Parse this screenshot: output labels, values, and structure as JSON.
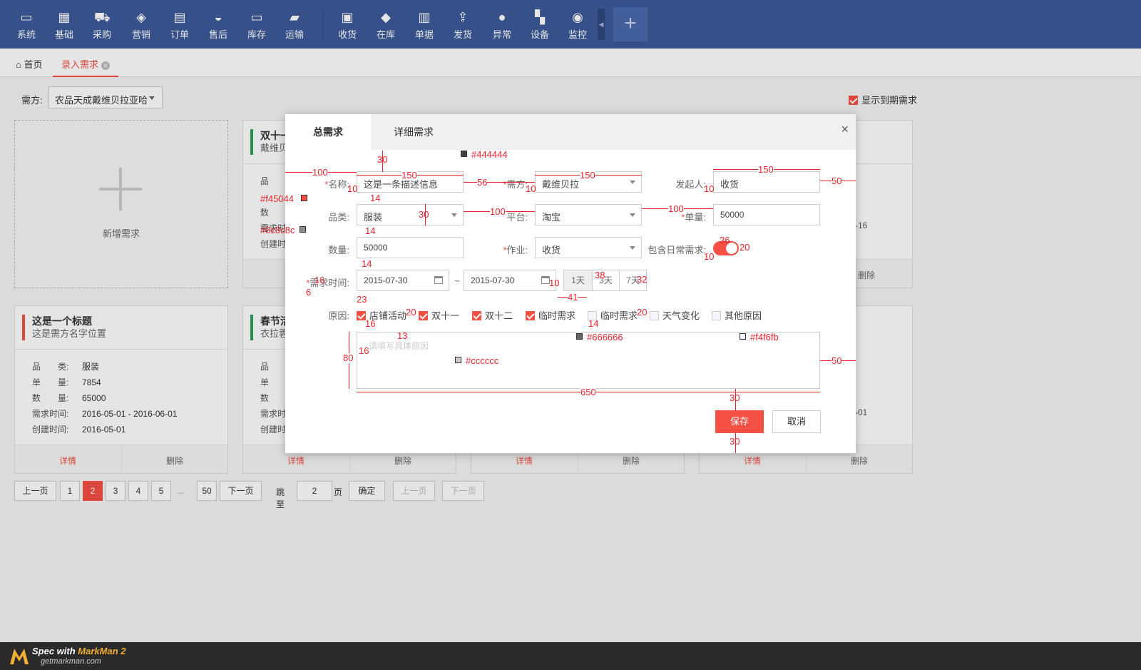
{
  "nav": {
    "items": [
      {
        "label": "系统",
        "icon": "monitor-icon"
      },
      {
        "label": "基础",
        "icon": "grid-icon"
      },
      {
        "label": "采购",
        "icon": "cart-icon"
      },
      {
        "label": "营销",
        "icon": "tag-icon"
      },
      {
        "label": "订单",
        "icon": "document-icon"
      },
      {
        "label": "售后",
        "icon": "headset-icon"
      },
      {
        "label": "库存",
        "icon": "inbox-icon"
      },
      {
        "label": "运输",
        "icon": "truck-icon"
      },
      {
        "label": "收货",
        "icon": "receive-icon"
      },
      {
        "label": "在库",
        "icon": "layers-icon"
      },
      {
        "label": "单据",
        "icon": "receipt-icon"
      },
      {
        "label": "发货",
        "icon": "upload-icon"
      },
      {
        "label": "异常",
        "icon": "alert-icon"
      },
      {
        "label": "设备",
        "icon": "devices-icon"
      },
      {
        "label": "监控",
        "icon": "camera-icon"
      }
    ],
    "add_label": "+"
  },
  "tabs": {
    "home": "首页",
    "active": "录入需求"
  },
  "filter": {
    "label": "需方:",
    "value": "农品天成戴维贝拉亚哈",
    "show_expired": "显示到期需求"
  },
  "cards": {
    "new_label": "新增需求",
    "c1": {
      "title": "这是一个标题",
      "subtitle": "这是需方名字位置",
      "rows": [
        {
          "k": "品　　类:",
          "v": "服装"
        },
        {
          "k": "单　　量:",
          "v": "7854"
        },
        {
          "k": "数　　量:",
          "v": "65000"
        },
        {
          "k": "需求时间:",
          "v": "2016-05-01 - 2016-06-01"
        },
        {
          "k": "创建时间:",
          "v": "2016-05-01"
        }
      ]
    },
    "c2_title": "双十一",
    "c2_sub": "戴维贝",
    "c3_title": "春节活",
    "c3_sub": "衣拉蓉",
    "partial_keys": [
      "品",
      "单",
      "数",
      "需求时",
      "创建时"
    ],
    "partial_keys_top": [
      "品",
      "数",
      "需求时",
      "创建时"
    ],
    "right_val_top": "-16",
    "right_val_bottom": "-01",
    "detail": "详情",
    "delete": "删除"
  },
  "pager": {
    "prev": "上一页",
    "next": "下一页",
    "pages": [
      "1",
      "2",
      "3",
      "4",
      "5"
    ],
    "ellipsis": "...",
    "last": "50",
    "jump_label": "跳至",
    "jump_value": "2",
    "page_unit": "页",
    "confirm": "确定",
    "prev2": "上一页",
    "next2": "下一页"
  },
  "modal": {
    "tab_total": "总需求",
    "tab_detail": "详细需求",
    "close": "×",
    "fields": {
      "name_label": "名称:",
      "name_value": "这是一条描述信息",
      "demand_label": "需方:",
      "demand_value": "戴维贝拉",
      "initiator_label": "发起人:",
      "initiator_value": "收货",
      "category_label": "品类:",
      "category_value": "服装",
      "platform_label": "平台:",
      "platform_value": "淘宝",
      "unit_label": "单量:",
      "unit_value": "50000",
      "qty_label": "数量:",
      "qty_value": "50000",
      "job_label": "作业:",
      "job_value": "收货",
      "daily_label": "包含日常需求:",
      "time_label": "需求时间:",
      "date_from": "2015-07-30",
      "date_to": "2015-07-30",
      "date_sep": "~",
      "seg_1": "1天",
      "seg_3": "3天",
      "seg_7": "7天",
      "reason_label": "原因:",
      "reasons": [
        "店铺活动",
        "双十一",
        "双十二",
        "临时需求",
        "临时需求",
        "天气变化",
        "其他原因"
      ],
      "textarea_placeholder": "请填写具体原因"
    },
    "save": "保存",
    "cancel": "取消"
  },
  "annotations": {
    "c_444": "#444444",
    "c_f45044": "#f45044",
    "c_8c8c8c": "#8c8c8c",
    "c_666": "#666666",
    "c_f4f6fb": "#f4f6fb",
    "c_ccc": "#cccccc",
    "n30a": "30",
    "n150a": "150",
    "n100a": "100",
    "n10a": "10",
    "n14a": "14",
    "n56": "56",
    "n150b": "150",
    "n10b": "10",
    "n150c": "150",
    "n50a": "50",
    "n10c": "10",
    "n30b": "30",
    "n100b": "100",
    "n100c": "100",
    "n14b": "14",
    "n36": "36",
    "n20a": "20",
    "n10d": "10",
    "n14c": "14",
    "n16a": "16",
    "n6": "6",
    "n23": "23",
    "n38": "38",
    "n32": "32",
    "n10e": "10",
    "n41": "41",
    "n16b": "16",
    "n20b": "20",
    "n14d": "14",
    "n20c": "20",
    "n13": "13",
    "n80": "80",
    "n16c": "16",
    "n650": "650",
    "n50b": "50",
    "n30c": "30",
    "n30d": "30"
  },
  "footer": {
    "spec_prefix": "Spec with ",
    "spec_brand": "MarkMan 2",
    "site": "getmarkman.com"
  }
}
